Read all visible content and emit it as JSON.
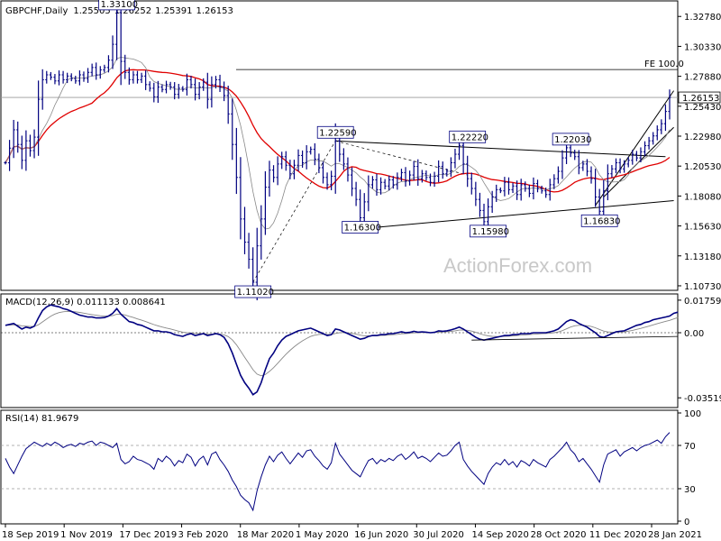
{
  "chart_data": [
    {
      "panel": "price",
      "type": "line",
      "symbol_label": "GBPCHF,Daily",
      "ohlc": {
        "open": "1.25505",
        "high": "1.26252",
        "low": "1.25391",
        "close": "1.26153"
      },
      "current_price_label": "1.26153",
      "fe_label": "FE 100.0",
      "fe_level": 1.2843,
      "ylim": [
        1.1058,
        1.3383
      ],
      "y_ticks": [
        "1.32780",
        "1.30330",
        "1.27880",
        "1.25430",
        "1.22980",
        "1.20530",
        "1.18080",
        "1.15630",
        "1.13180",
        "1.10730"
      ],
      "x_ticks": [
        "18 Sep 2019",
        "1 Nov 2019",
        "17 Dec 2019",
        "3 Feb 2020",
        "18 Mar 2020",
        "1 May 2020",
        "16 Jun 2020",
        "30 Jul 2020",
        "14 Sep 2020",
        "28 Oct 2020",
        "11 Dec 2020",
        "28 Jan 2021"
      ],
      "annotations": [
        {
          "label": "1.33100",
          "t": 27
        },
        {
          "label": "1.22590",
          "t": 80
        },
        {
          "label": "1.22220",
          "t": 112
        },
        {
          "label": "1.22030",
          "t": 137
        },
        {
          "label": "1.16300",
          "t": 86
        },
        {
          "label": "1.15980",
          "t": 117
        },
        {
          "label": "1.16830",
          "t": 144
        },
        {
          "label": "1.11020",
          "t": 60
        }
      ],
      "series": [
        {
          "name": "",
          "color": "#000080",
          "values": [
            1.208,
            1.22,
            1.235,
            1.223,
            1.21,
            1.226,
            1.218,
            1.229,
            1.26,
            1.276,
            1.28,
            1.278,
            1.275,
            1.28,
            1.276,
            1.279,
            1.277,
            1.275,
            1.28,
            1.277,
            1.282,
            1.286,
            1.28,
            1.284,
            1.286,
            1.292,
            1.305,
            1.331,
            1.291,
            1.282,
            1.276,
            1.28,
            1.276,
            1.279,
            1.272,
            1.269,
            1.262,
            1.27,
            1.268,
            1.272,
            1.27,
            1.264,
            1.269,
            1.268,
            1.276,
            1.272,
            1.264,
            1.27,
            1.274,
            1.26,
            1.272,
            1.276,
            1.27,
            1.263,
            1.248,
            1.223,
            1.196,
            1.162,
            1.143,
            1.129,
            1.1102,
            1.14,
            1.162,
            1.188,
            1.202,
            1.196,
            1.207,
            1.213,
            1.206,
            1.199,
            1.206,
            1.214,
            1.208,
            1.217,
            1.219,
            1.211,
            1.204,
            1.196,
            1.19,
            1.197,
            1.2259,
            1.215,
            1.207,
            1.198,
            1.187,
            1.178,
            1.163,
            1.176,
            1.19,
            1.194,
            1.186,
            1.192,
            1.189,
            1.194,
            1.19,
            1.196,
            1.2,
            1.193,
            1.198,
            1.205,
            1.195,
            1.199,
            1.196,
            1.192,
            1.197,
            1.205,
            1.199,
            1.201,
            1.208,
            1.215,
            1.2222,
            1.207,
            1.195,
            1.187,
            1.178,
            1.169,
            1.1598,
            1.172,
            1.18,
            1.186,
            1.185,
            1.192,
            1.186,
            1.189,
            1.182,
            1.19,
            1.187,
            1.183,
            1.191,
            1.187,
            1.185,
            1.182,
            1.19,
            1.195,
            1.201,
            1.212,
            1.2203,
            1.216,
            1.213,
            1.204,
            1.207,
            1.201,
            1.195,
            1.18,
            1.1683,
            1.185,
            1.199,
            1.203,
            1.208,
            1.203,
            1.207,
            1.21,
            1.215,
            1.212,
            1.217,
            1.222,
            1.226,
            1.23,
            1.235,
            1.24,
            1.25,
            1.2615
          ]
        },
        {
          "name": "",
          "color": "#e00000",
          "values": []
        },
        {
          "name": "",
          "color": "#888888",
          "values": []
        }
      ]
    },
    {
      "panel": "macd",
      "type": "line",
      "label": "MACD(12,26,9) 0.011133 0.008641",
      "ylim": [
        -0.039,
        0.0195
      ],
      "y_ticks": [
        "0.017599",
        "0.00",
        "-0.035194"
      ],
      "series": [
        {
          "name": "",
          "color": "#000080",
          "values": [
            0.004,
            0.0045,
            0.005,
            0.0035,
            0.002,
            0.003,
            0.0025,
            0.0035,
            0.008,
            0.012,
            0.014,
            0.015,
            0.0145,
            0.014,
            0.013,
            0.0125,
            0.0115,
            0.0105,
            0.0095,
            0.009,
            0.0085,
            0.0085,
            0.008,
            0.008,
            0.0082,
            0.009,
            0.0105,
            0.013,
            0.01,
            0.008,
            0.006,
            0.0055,
            0.0045,
            0.004,
            0.003,
            0.002,
            0.001,
            0.001,
            0.0005,
            0.0005,
            0.0,
            -0.001,
            -0.0015,
            -0.002,
            -0.001,
            -0.0005,
            -0.0015,
            -0.001,
            -0.0005,
            -0.0015,
            -0.001,
            -0.0005,
            -0.001,
            -0.0025,
            -0.006,
            -0.011,
            -0.017,
            -0.023,
            -0.027,
            -0.03,
            -0.0335,
            -0.032,
            -0.027,
            -0.02,
            -0.014,
            -0.011,
            -0.007,
            -0.004,
            -0.002,
            -0.001,
            0.0,
            0.001,
            0.0015,
            0.002,
            0.0025,
            0.0015,
            0.0005,
            -0.0005,
            -0.0015,
            -0.001,
            0.002,
            0.0015,
            0.0005,
            -0.0005,
            -0.0015,
            -0.0025,
            -0.0035,
            -0.003,
            -0.002,
            -0.0015,
            -0.0015,
            -0.001,
            -0.001,
            -0.0005,
            -0.0005,
            0.0,
            0.0005,
            0.0,
            0.0002,
            0.0008,
            0.0003,
            0.0005,
            0.0003,
            0.0,
            0.0002,
            0.001,
            0.0008,
            0.001,
            0.0015,
            0.0022,
            0.003,
            0.002,
            0.0005,
            -0.001,
            -0.0025,
            -0.0035,
            -0.004,
            -0.0035,
            -0.003,
            -0.0025,
            -0.002,
            -0.0015,
            -0.0015,
            -0.001,
            -0.001,
            -0.0005,
            -0.0005,
            -0.0005,
            0.0,
            0.0,
            0.0,
            0.0,
            0.0005,
            0.001,
            0.002,
            0.004,
            0.006,
            0.007,
            0.0065,
            0.005,
            0.004,
            0.003,
            0.0015,
            0.0,
            -0.002,
            -0.0025,
            -0.0015,
            -0.0005,
            0.0005,
            0.0008,
            0.001,
            0.002,
            0.003,
            0.004,
            0.0045,
            0.0055,
            0.006,
            0.007,
            0.0075,
            0.008,
            0.0085,
            0.009,
            0.0105,
            0.0111
          ]
        },
        {
          "name": "",
          "color": "#888888",
          "values": []
        }
      ]
    },
    {
      "panel": "rsi",
      "type": "line",
      "label": "RSI(14) 81.9679",
      "ylim": [
        0,
        100
      ],
      "y_ticks": [
        "100",
        "70",
        "30",
        "0"
      ],
      "series": [
        {
          "name": "",
          "color": "#000080",
          "values": [
            58,
            50,
            44,
            52,
            60,
            67,
            70,
            73,
            71,
            69,
            72,
            70,
            73,
            71,
            68,
            70,
            71,
            69,
            72,
            71,
            73,
            74,
            70,
            73,
            72,
            70,
            68,
            72,
            57,
            53,
            55,
            60,
            57,
            56,
            54,
            52,
            48,
            58,
            55,
            60,
            57,
            51,
            56,
            54,
            62,
            59,
            51,
            57,
            60,
            52,
            62,
            64,
            57,
            52,
            46,
            38,
            32,
            24,
            20,
            17,
            10,
            28,
            41,
            52,
            60,
            55,
            61,
            64,
            58,
            53,
            58,
            63,
            59,
            65,
            66,
            60,
            56,
            51,
            48,
            54,
            72,
            62,
            57,
            52,
            47,
            44,
            41,
            49,
            56,
            58,
            53,
            57,
            55,
            58,
            56,
            60,
            62,
            57,
            60,
            64,
            58,
            60,
            58,
            55,
            59,
            63,
            60,
            61,
            65,
            70,
            73,
            57,
            51,
            46,
            42,
            38,
            34,
            44,
            50,
            54,
            52,
            57,
            52,
            55,
            50,
            56,
            54,
            51,
            57,
            54,
            52,
            50,
            57,
            60,
            64,
            68,
            73,
            66,
            62,
            55,
            58,
            53,
            48,
            42,
            36,
            52,
            62,
            64,
            66,
            60,
            64,
            66,
            68,
            65,
            68,
            70,
            71,
            73,
            75,
            72,
            78,
            82
          ]
        }
      ]
    }
  ],
  "watermark": "ActionForex.com"
}
